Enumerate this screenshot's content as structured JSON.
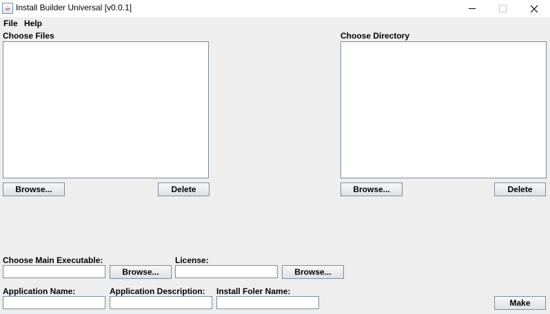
{
  "window": {
    "title": "Install Builder Universal [v0.0.1]",
    "icon": "java-coffee-icon"
  },
  "menu": [
    {
      "label": "File"
    },
    {
      "label": "Help"
    }
  ],
  "files": {
    "label": "Choose Files",
    "browse_label": "Browse...",
    "delete_label": "Delete"
  },
  "directory": {
    "label": "Choose Directory",
    "browse_label": "Browse...",
    "delete_label": "Delete"
  },
  "main_executable": {
    "label": "Choose Main Executable:",
    "value": "",
    "browse_label": "Browse..."
  },
  "license": {
    "label": "License:",
    "value": "",
    "browse_label": "Browse..."
  },
  "app_name": {
    "label": "Application Name:",
    "value": ""
  },
  "app_description": {
    "label": "Application Description:",
    "value": ""
  },
  "install_folder": {
    "label": "Install Foler Name:",
    "value": ""
  },
  "make_label": "Make"
}
